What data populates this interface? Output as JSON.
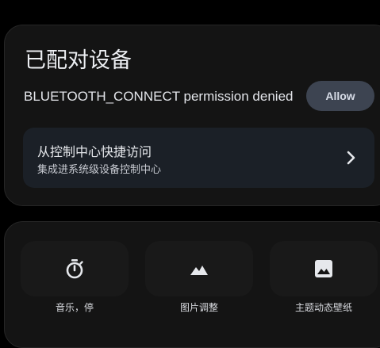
{
  "paired_devices": {
    "title": "已配对设备",
    "permission_message": "BLUETOOTH_CONNECT permission denied",
    "allow_label": "Allow",
    "quick_access": {
      "title": "从控制中心快捷访问",
      "subtitle": "集成进系统级设备控制中心"
    }
  },
  "shortcuts": [
    {
      "label": "音乐，停",
      "icon": "timer-icon"
    },
    {
      "label": "图片调整",
      "icon": "landscape-icon"
    },
    {
      "label": "主题动态壁纸",
      "icon": "image-icon"
    }
  ],
  "colors": {
    "background": "#000000",
    "card": "#141414",
    "allow_button": "#3d4451",
    "quick_row": "#1b2027",
    "tile": "#191919"
  }
}
